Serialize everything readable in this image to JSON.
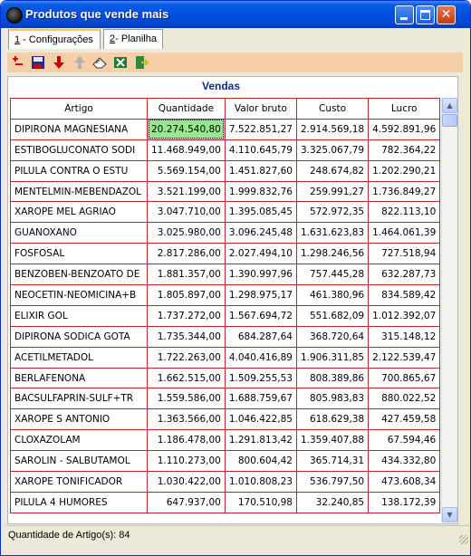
{
  "window": {
    "title": "Produtos que vende mais",
    "controls": {
      "minimize": "",
      "maximize": "",
      "close": "✕"
    }
  },
  "tabs": [
    {
      "number": "1",
      "label": " - Configurações"
    },
    {
      "number": "2",
      "label": "- Planilha"
    }
  ],
  "toolbar": {
    "icons": [
      "add-row-icon",
      "save-icon",
      "move-down-icon",
      "move-up-icon",
      "eraser-icon",
      "excel-export-icon",
      "exit-icon"
    ]
  },
  "grid": {
    "title": "Vendas",
    "columns": [
      "Artigo",
      "Quantidade",
      "Valor bruto",
      "Custo",
      "Lucro"
    ],
    "rows": [
      [
        "DIPIRONA MAGNESIANA",
        "20.274.540,80",
        "7.522.851,27",
        "2.914.569,18",
        "4.592.891,96"
      ],
      [
        "ESTIBOGLUCONATO SODI",
        "11.468.949,00",
        "4.110.645,79",
        "3.325.067,79",
        "782.364,22"
      ],
      [
        "PILULA CONTRA O ESTU",
        "5.569.154,00",
        "1.451.827,60",
        "248.674,82",
        "1.202.290,21"
      ],
      [
        "MENTELMIN-MEBENDAZOL",
        "3.521.199,00",
        "1.999.832,76",
        "259.991,27",
        "1.736.849,27"
      ],
      [
        "XAROPE MEL AGRIAO",
        "3.047.710,00",
        "1.395.085,45",
        "572.972,35",
        "822.113,10"
      ],
      [
        "GUANOXANO",
        "3.025.980,00",
        "3.096.245,48",
        "1.631.623,83",
        "1.464.061,39"
      ],
      [
        "FOSFOSAL",
        "2.817.286,00",
        "2.027.494,10",
        "1.298.246,56",
        "727.518,94"
      ],
      [
        "BENZOBEN-BENZOATO DE",
        "1.881.357,00",
        "1.390.997,96",
        "757.445,28",
        "632.287,73"
      ],
      [
        "NEOCETIN-NEOMICINA+B",
        "1.805.897,00",
        "1.298.975,17",
        "461.380,96",
        "834.589,42"
      ],
      [
        "ELIXIR GOL",
        "1.737.272,00",
        "1.567.694,72",
        "551.682,09",
        "1.012.392,07"
      ],
      [
        "DIPIRONA SODICA GOTA",
        "1.735.344,00",
        "684.287,64",
        "368.720,64",
        "315.148,12"
      ],
      [
        "ACETILMETADOL",
        "1.722.263,00",
        "4.040.416,89",
        "1.906.311,85",
        "2.122.539,47"
      ],
      [
        "BERLAFENONA",
        "1.662.515,00",
        "1.509.255,53",
        "808.389,86",
        "700.865,67"
      ],
      [
        "BACSULFAPRIN-SULF+TR",
        "1.559.586,00",
        "1.688.759,67",
        "805.983,83",
        "880.022,52"
      ],
      [
        "XAROPE S ANTONIO",
        "1.363.566,00",
        "1.046.422,85",
        "618.629,38",
        "427.459,58"
      ],
      [
        "CLOXAZOLAM",
        "1.186.478,00",
        "1.291.813,42",
        "1.359.407,88",
        "67.594,46"
      ],
      [
        "SAROLIN - SALBUTAMOL",
        "1.110.273,00",
        "800.604,42",
        "365.714,31",
        "434.332,80"
      ],
      [
        "XAROPE TONIFICADOR",
        "1.030.422,00",
        "1.010.808,23",
        "536.797,50",
        "473.608,34"
      ],
      [
        "PILULA 4 HUMORES",
        "647.937,00",
        "170.510,98",
        "32.240,85",
        "138.172,39"
      ]
    ]
  },
  "statusbar": {
    "text": "Quantidade de Artigo(s): 84"
  },
  "colors": {
    "title_bar": "#0050e0",
    "toolbar_bg": "#f6cfa8",
    "grid_border": "#c0242f",
    "highlight_cell": "#96e88c",
    "grid_title": "#0a2a8c"
  }
}
